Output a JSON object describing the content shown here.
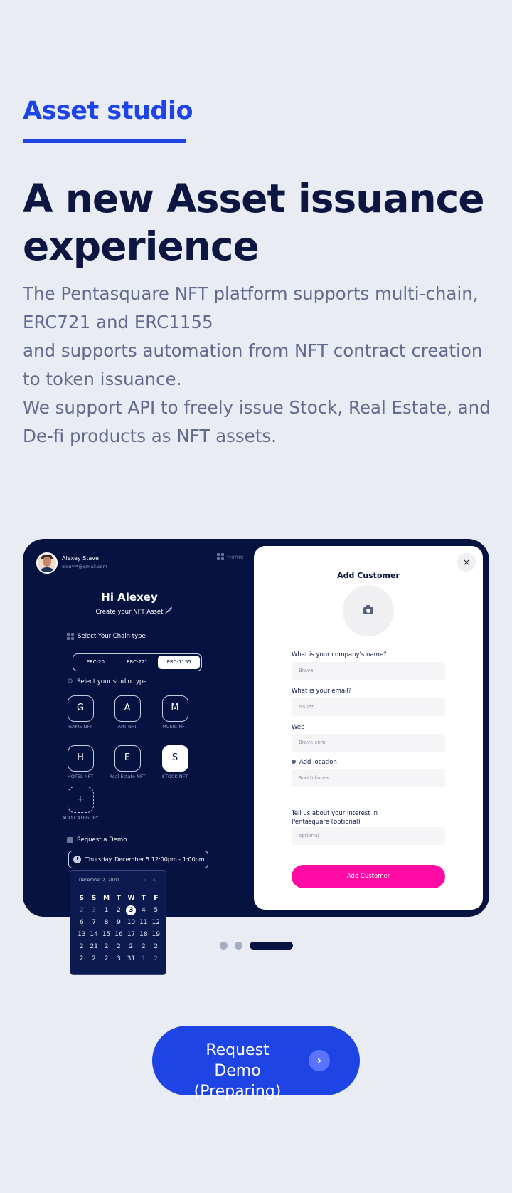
{
  "hero": {
    "eyebrow": "Asset studio",
    "headline": "A new Asset issuance experience",
    "paragraphs": [
      "The Pentasquare NFT platform supports multi-chain, ERC721 and ERC1155",
      "and supports automation from NFT contract creation to token issuance.",
      "We support API to freely issue Stock, Real Estate, and De-fi products as NFT assets."
    ]
  },
  "dashboard": {
    "user_name": "Alexey Stave",
    "user_email": "olex***@gmail.com",
    "home_label": "Home",
    "greeting": "Hi Alexey",
    "subtitle": "Create your NFT Asset",
    "chain_label": "Select Your Chain type",
    "chain_options": [
      "ERC-20",
      "ERC-721",
      "ERC-1155"
    ],
    "chain_selected": "ERC-1155",
    "studio_label": "Select your studio type",
    "studio_types": [
      {
        "letter": "G",
        "label": "GAME NFT"
      },
      {
        "letter": "A",
        "label": "ART NFT"
      },
      {
        "letter": "M",
        "label": "MUSIC NFT"
      },
      {
        "letter": "H",
        "label": "HOTEL NFT"
      },
      {
        "letter": "E",
        "label": "Real Estate NFT"
      },
      {
        "letter": "S",
        "label": "STOCK NFT"
      }
    ],
    "add_category": {
      "symbol": "+",
      "label": "ADD CATEGORY"
    },
    "demo_label": "Request a Demo",
    "demo_value": "Thursday. December 5  12:00pm - 1:00pm",
    "calendar": {
      "month_label": "December 2, 2020",
      "nav": "◃ ▹",
      "weekdays": [
        "S",
        "S",
        "M",
        "T",
        "W",
        "T",
        "F"
      ],
      "days": [
        "2",
        "3",
        "1",
        "2",
        "3",
        "4",
        "5",
        "6",
        "7",
        "8",
        "9",
        "10",
        "11",
        "12",
        "13",
        "14",
        "15",
        "16",
        "17",
        "18",
        "19",
        "2",
        "21",
        "2",
        "2",
        "2",
        "2",
        "2",
        "2",
        "2",
        "2",
        "3",
        "31",
        "1",
        "2"
      ],
      "selected": "3"
    }
  },
  "modal": {
    "title": "Add  Customer",
    "close": "×",
    "fields": [
      {
        "label": "What is your company's name?",
        "placeholder": "Brave"
      },
      {
        "label": "What is your email?",
        "placeholder": "Issuer"
      },
      {
        "label": "Web",
        "placeholder": "Brave.com"
      },
      {
        "label": "Add location",
        "placeholder": "South korea"
      },
      {
        "label": "Tell us about your interest in Pentasquare (optional)",
        "placeholder": "optional"
      }
    ],
    "submit": "Add Customer"
  },
  "carousel": {
    "count": 3,
    "active": 3
  },
  "cta": {
    "label": "Request Demo (Preparing)",
    "arrow": "›"
  },
  "colors": {
    "accent": "#1f44e6",
    "navy": "#06123f",
    "pink": "#ff0aa3",
    "background": "#e9ecf2"
  }
}
